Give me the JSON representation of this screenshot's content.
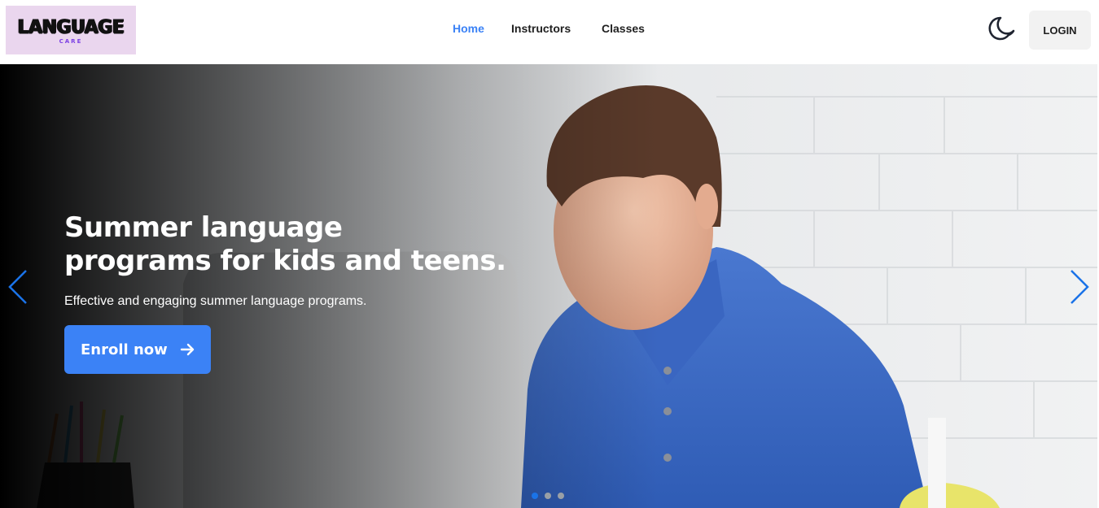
{
  "navbar": {
    "logo": {
      "word": "LANGUAGE",
      "sub": "CARE"
    },
    "links": [
      {
        "label": "Home",
        "active": true
      },
      {
        "label": "Instructors",
        "active": false
      },
      {
        "label": "Classes",
        "active": false
      }
    ],
    "theme_toggle_icon": "moon-icon",
    "login_label": "LOGIN"
  },
  "hero": {
    "title_line1": "Summer language",
    "title_line2": "programs for kids and teens.",
    "subtitle": "Effective and engaging summer language programs.",
    "cta_label": "Enroll now",
    "cta_icon": "arrow-right-icon",
    "prev_icon": "chevron-left-icon",
    "next_icon": "chevron-right-icon",
    "slides_count": 3,
    "active_slide": 1
  },
  "colors": {
    "accent": "#3b82f6",
    "logo_bg": "#ead6ee",
    "logo_sub": "#7b3fe4",
    "login_bg": "#f2f2f2"
  }
}
